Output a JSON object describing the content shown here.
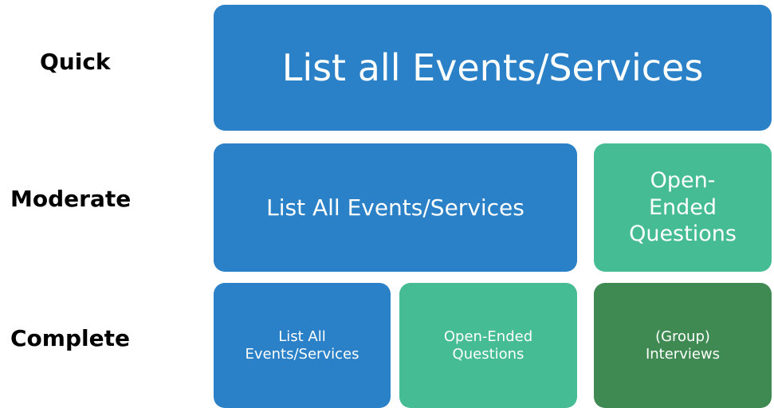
{
  "colors": {
    "blue": "#2b81c7",
    "teal": "#45bc94",
    "green": "#3f8a52",
    "label": "#000000"
  },
  "rows": {
    "quick": {
      "label": "Quick",
      "boxes": [
        {
          "text": "List all Events/Services",
          "color": "blue"
        }
      ]
    },
    "moderate": {
      "label": "Moderate",
      "boxes": [
        {
          "text": "List All Events/Services",
          "color": "blue"
        },
        {
          "text": "Open-\nEnded\nQuestions",
          "color": "teal"
        }
      ]
    },
    "complete": {
      "label": "Complete",
      "boxes": [
        {
          "text": "List All\nEvents/Services",
          "color": "blue"
        },
        {
          "text": "Open-Ended\nQuestions",
          "color": "teal"
        },
        {
          "text": "(Group)\nInterviews",
          "color": "green"
        }
      ]
    }
  }
}
